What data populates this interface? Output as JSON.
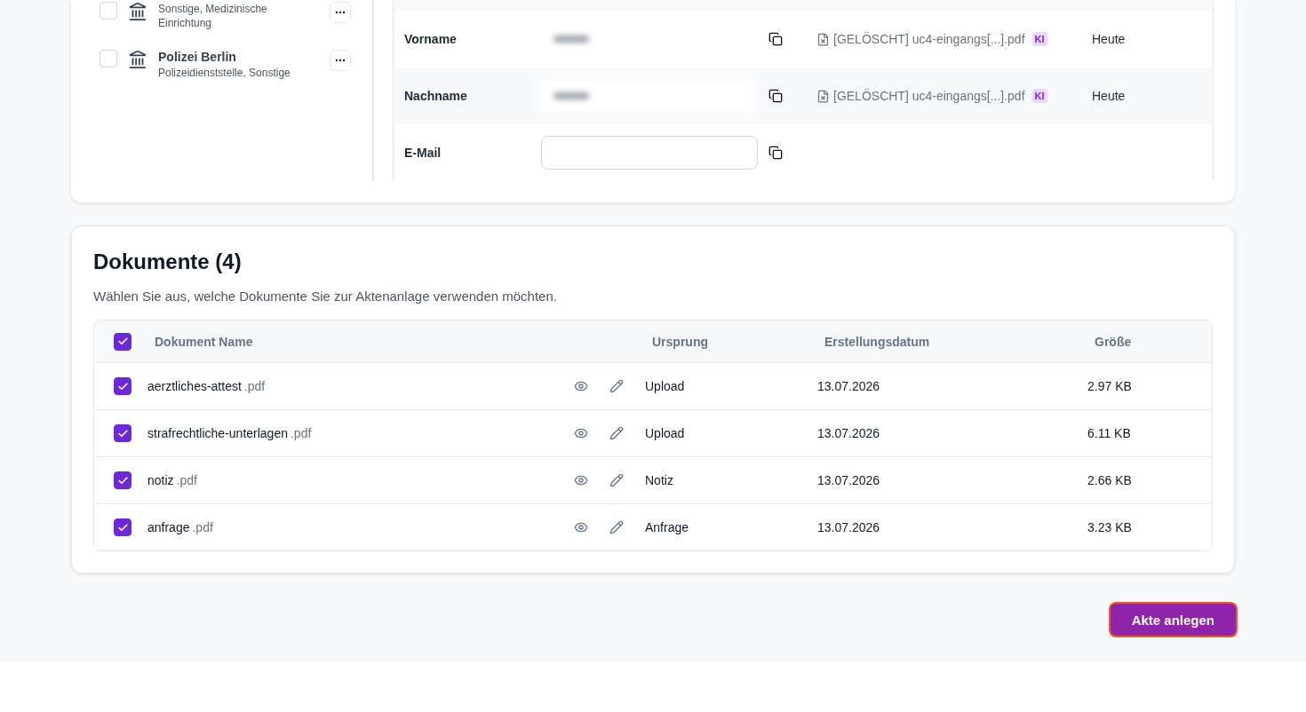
{
  "entities": [
    {
      "subtitle": "Sonstige, Medizinische Einrichtung",
      "checked": false
    },
    {
      "name": "Polizei Berlin",
      "subtitle": "Polizeidienststelle, Sonstige",
      "checked": false
    }
  ],
  "fields": [
    {
      "label": "Vorname",
      "kind": "blurred",
      "source": "[GELÖSCHT] uc4-eingangs[...].pdf",
      "badge": "KI",
      "date": "Heute"
    },
    {
      "label": "Nachname",
      "kind": "blurred",
      "source": "[GELÖSCHT] uc4-eingangs[...].pdf",
      "badge": "KI",
      "date": "Heute"
    },
    {
      "label": "E-Mail",
      "kind": "input"
    }
  ],
  "documents": {
    "title": "Dokumente (4)",
    "description": "Wählen Sie aus, welche Dokumente Sie zur Aktenanlage verwenden möchten.",
    "all_checked": true,
    "columns": [
      "Dokument Name",
      "Ursprung",
      "Erstellungsdatum",
      "Größe"
    ],
    "rows": [
      {
        "name": "aerztliches-attest",
        "ext": ".pdf",
        "origin": "Upload",
        "date": "13.07.2026",
        "size": "2.97 KB",
        "checked": true
      },
      {
        "name": "strafrechtliche-unterlagen",
        "ext": ".pdf",
        "origin": "Upload",
        "date": "13.07.2026",
        "size": "6.11 KB",
        "checked": true
      },
      {
        "name": "notiz",
        "ext": ".pdf",
        "origin": "Notiz",
        "date": "13.07.2026",
        "size": "2.66 KB",
        "checked": true
      },
      {
        "name": "anfrage",
        "ext": ".pdf",
        "origin": "Anfrage",
        "date": "13.07.2026",
        "size": "3.23 KB",
        "checked": true
      }
    ]
  },
  "primary_button": {
    "label": "Akte anlegen",
    "focused": true
  }
}
